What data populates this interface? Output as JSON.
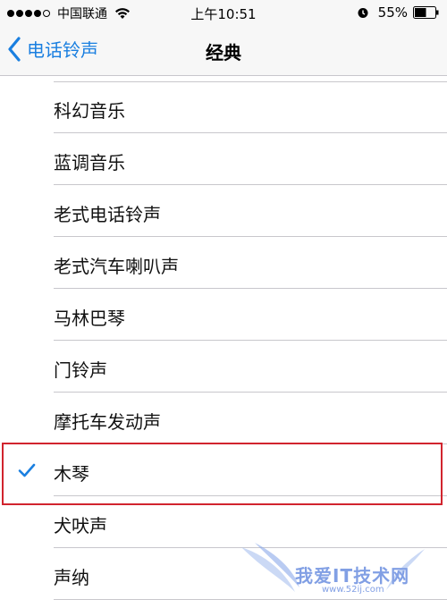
{
  "status_bar": {
    "carrier": "中国联通",
    "time": "上午10:51",
    "battery": "55%",
    "icons": [
      "signal-dots-icon",
      "wifi-icon",
      "alarm-icon",
      "battery-icon"
    ]
  },
  "nav": {
    "back_label": "电话铃声",
    "title": "经典",
    "accent_color": "#1a7fe0"
  },
  "list": {
    "items": [
      {
        "label": "科幻音乐",
        "selected": false
      },
      {
        "label": "蓝调音乐",
        "selected": false
      },
      {
        "label": "老式电话铃声",
        "selected": false
      },
      {
        "label": "老式汽车喇叭声",
        "selected": false
      },
      {
        "label": "马林巴琴",
        "selected": false
      },
      {
        "label": "门铃声",
        "selected": false
      },
      {
        "label": "摩托车发动声",
        "selected": false
      },
      {
        "label": "木琴",
        "selected": true
      },
      {
        "label": "犬吠声",
        "selected": false
      },
      {
        "label": "声纳",
        "selected": false
      }
    ],
    "highlight_color": "#d1242e"
  },
  "watermark": {
    "text": "我爱IT技术网",
    "url": "www.52ij.com"
  }
}
